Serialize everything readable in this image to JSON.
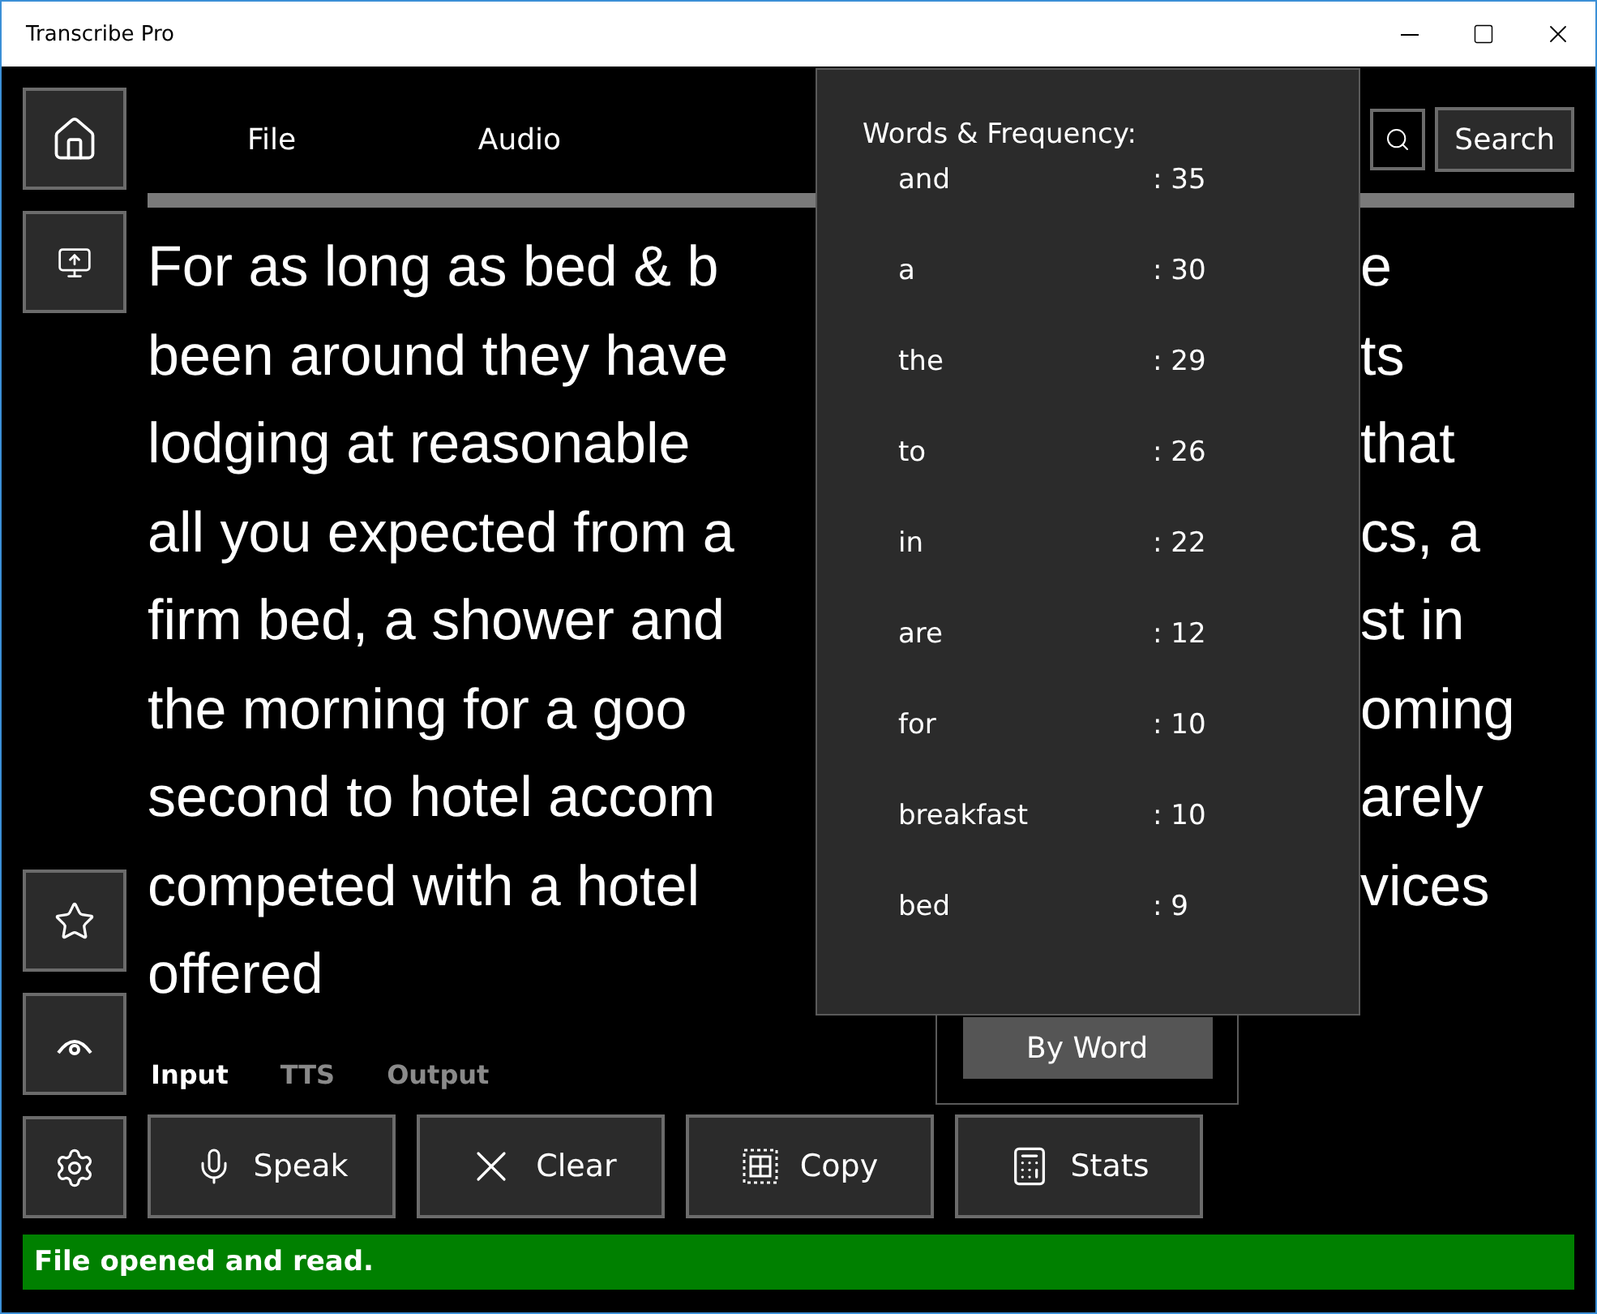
{
  "window": {
    "title": "Transcribe Pro"
  },
  "menu": [
    "File",
    "Audio"
  ],
  "search": {
    "button": "Search"
  },
  "text_lines": [
    {
      "left": "For as long as bed & b",
      "right": "e"
    },
    {
      "left": "been around they have",
      "right": "ts"
    },
    {
      "left": "lodging at reasonable",
      "right": "that"
    },
    {
      "left": "all you expected from a",
      "right": "cs, a"
    },
    {
      "left": "firm bed, a shower and",
      "right": "st in"
    },
    {
      "left": "the morning for a goo",
      "right": "oming"
    },
    {
      "left": "second to hotel accom",
      "right": "arely"
    },
    {
      "left": "competed with a hotel",
      "right": "vices"
    },
    {
      "left": "offered"
    }
  ],
  "tabs": [
    {
      "label": "Input",
      "selected": true
    },
    {
      "label": "TTS",
      "selected": false
    },
    {
      "label": "Output",
      "selected": false
    }
  ],
  "buttons": [
    {
      "kind": "speak",
      "label": "Speak"
    },
    {
      "kind": "clear",
      "label": "Clear"
    },
    {
      "kind": "copy",
      "label": "Copy"
    },
    {
      "kind": "stats",
      "label": "Stats"
    }
  ],
  "sort_button": "By Word",
  "popup": {
    "title": "Words & Frequency:",
    "rows": [
      {
        "word": "and",
        "count": ": 35"
      },
      {
        "word": "a",
        "count": ": 30"
      },
      {
        "word": "the",
        "count": ": 29"
      },
      {
        "word": "to",
        "count": ": 26"
      },
      {
        "word": "in",
        "count": ": 22"
      },
      {
        "word": "are",
        "count": ": 12"
      },
      {
        "word": "for",
        "count": ": 10"
      },
      {
        "word": "breakfast",
        "count": ": 10"
      },
      {
        "word": "bed",
        "count": ": 9"
      }
    ]
  },
  "status_bar": "File opened and read."
}
